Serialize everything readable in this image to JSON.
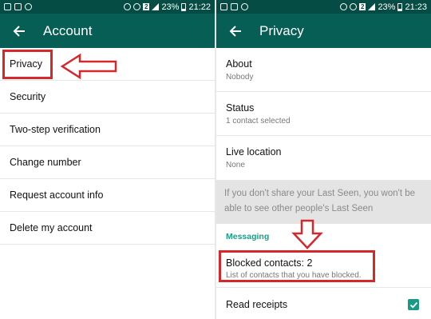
{
  "left_panel": {
    "status_time": "21:22",
    "battery": "23%",
    "sim_label": "2",
    "title": "Account",
    "items": [
      "Privacy",
      "Security",
      "Two-step verification",
      "Change number",
      "Request account info",
      "Delete my account"
    ]
  },
  "right_panel": {
    "status_time": "21:23",
    "battery": "23%",
    "sim_label": "2",
    "title": "Privacy",
    "about": {
      "title": "About",
      "value": "Nobody"
    },
    "status": {
      "title": "Status",
      "value": "1 contact selected"
    },
    "live_location": {
      "title": "Live location",
      "value": "None"
    },
    "note": "If you don't share your Last Seen, you won't be able to see other people's Last Seen",
    "section_label": "Messaging",
    "blocked": {
      "title": "Blocked contacts: 2",
      "subtitle": "List of contacts that you have blocked."
    },
    "read_receipts": {
      "title": "Read receipts",
      "checked": true
    }
  },
  "colors": {
    "statusbar": "#054d44",
    "appbar": "#075e54",
    "accent": "#1a9e86",
    "annotation": "#d5282b"
  }
}
